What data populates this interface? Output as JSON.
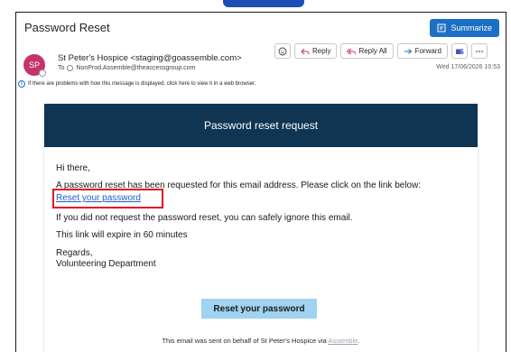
{
  "window": {
    "title": "Password Reset",
    "summarize_label": "Summarize"
  },
  "header": {
    "avatar_initials": "SP",
    "sender": "St Peter's Hospice <staging@goassemble.com>",
    "to_label": "To",
    "recipient": "NonProd.Assemble@theaccessgroup.com",
    "date": "Wed 17/06/2026 10:53",
    "actions": {
      "reply_label": "Reply",
      "reply_all_label": "Reply All",
      "forward_label": "Forward"
    }
  },
  "info_bar": {
    "text": "If there are problems with how this message is displayed, click here to view it in a web browser."
  },
  "email": {
    "banner_title": "Password reset request",
    "greeting": "Hi there,",
    "intro": "A password reset has been requested for this email address. Please click on the link below:",
    "link_text": "Reset your password",
    "ignore_note": "If you did not request the password reset, you can safely ignore this email.",
    "expiry": "This link will expire in 60 minutes",
    "sign_off": "Regards,",
    "department": "Volunteering Department",
    "button_label": "Reset your password"
  },
  "footer": {
    "text": "This email was sent on behalf of St Peter's Hospice via",
    "brand": "Assemble",
    "end": "."
  },
  "colors": {
    "banner": "#0f3552",
    "summarize": "#1d6fc6",
    "avatar": "#c2346b",
    "button": "#9fd3f0",
    "highlight": "#e3121f",
    "link": "#1a5fd0"
  }
}
